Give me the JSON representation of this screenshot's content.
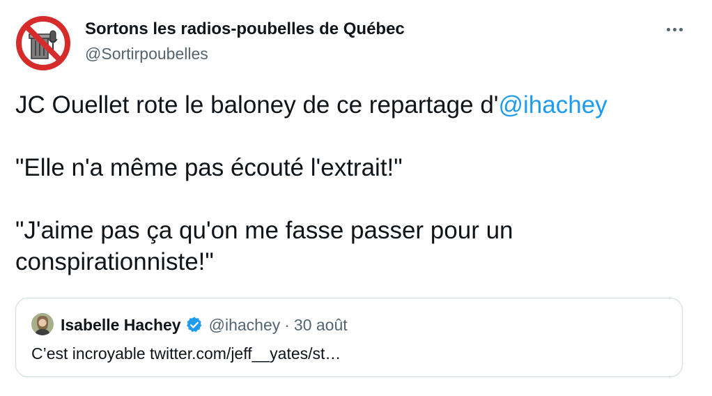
{
  "author": {
    "name": "Sortons les radios-poubelles de Québec",
    "handle": "@Sortirpoubelles",
    "avatar_icon": "no-trash-radio-logo",
    "avatar_color": "#d62b2b"
  },
  "tweet": {
    "line1_prefix": "JC Ouellet rote le baloney de ce repartage d'",
    "line1_mention": "@ihachey",
    "paragraph2": "\"Elle n'a même pas écouté l'extrait!\"",
    "paragraph3": "\"J'aime pas ça qu'on me fasse passer pour un conspirationniste!\""
  },
  "quote": {
    "name": "Isabelle Hachey",
    "verified_icon": "verified-badge-icon",
    "handle": "@ihachey",
    "separator": "·",
    "date": "30 août",
    "text": "C’est incroyable twitter.com/jeff__yates/st…"
  },
  "more_icon": "more-options-icon",
  "colors": {
    "link": "#1d9bf0",
    "secondary_text": "#536471",
    "border": "#cfd9de"
  }
}
